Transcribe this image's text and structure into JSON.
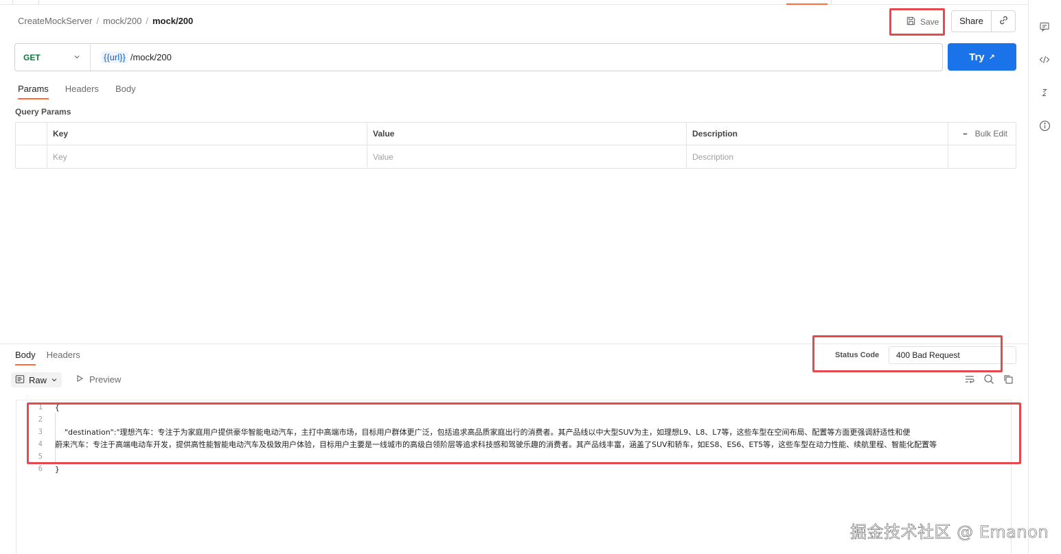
{
  "breadcrumb": {
    "items": [
      "CreateMockServer",
      "mock/200"
    ],
    "current": "mock/200",
    "separator": "/"
  },
  "toolbar": {
    "save_label": "Save",
    "share_label": "Share"
  },
  "request": {
    "method": "GET",
    "url_variable": "{{url}}",
    "url_path": "/mock/200",
    "try_label": "Try",
    "try_arrow": "↗",
    "tabs": [
      "Params",
      "Headers",
      "Body"
    ],
    "active_tab": "Params"
  },
  "params": {
    "section_label": "Query Params",
    "columns": [
      "Key",
      "Value",
      "Description"
    ],
    "bulk_edit_label": "Bulk Edit",
    "more_icon": "•••",
    "placeholders": [
      "Key",
      "Value",
      "Description"
    ]
  },
  "response": {
    "tabs": [
      "Body",
      "Headers"
    ],
    "active_tab": "Body",
    "status_label": "Status Code",
    "status_value": "400 Bad Request",
    "format_label": "Raw",
    "preview_label": "Preview",
    "lines": [
      {
        "num": "1",
        "text": "{"
      },
      {
        "num": "2",
        "text": ""
      },
      {
        "num": "3",
        "text": "    \"destination\":\"理想汽车：专注于为家庭用户提供豪华智能电动汽车，主打中高端市场，目标用户群体更广泛，包括追求高品质家庭出行的消费者。其产品线以中大型SUV为主，如理想L9、L8、L7等，这些车型在空间布局、配置等方面更强调舒适性和便"
      },
      {
        "num": "4",
        "text": "蔚来汽车：专注于高端电动车开发，提供高性能智能电动汽车及极致用户体验，目标用户主要是一线城市的高级白领阶层等追求科技感和驾驶乐趣的消费者。其产品线丰富，涵盖了SUV和轿车，如ES8、ES6、ET5等，这些车型在动力性能、续航里程、智能化配置等"
      },
      {
        "num": "5",
        "text": ""
      },
      {
        "num": "6",
        "text": "}"
      }
    ]
  },
  "watermark": "掘金技术社区 @ Emanon",
  "colors": {
    "accent": "#ff6c37",
    "primary": "#1a73e8",
    "method_get": "#0b7a3e",
    "annotation": "#e5484d"
  }
}
